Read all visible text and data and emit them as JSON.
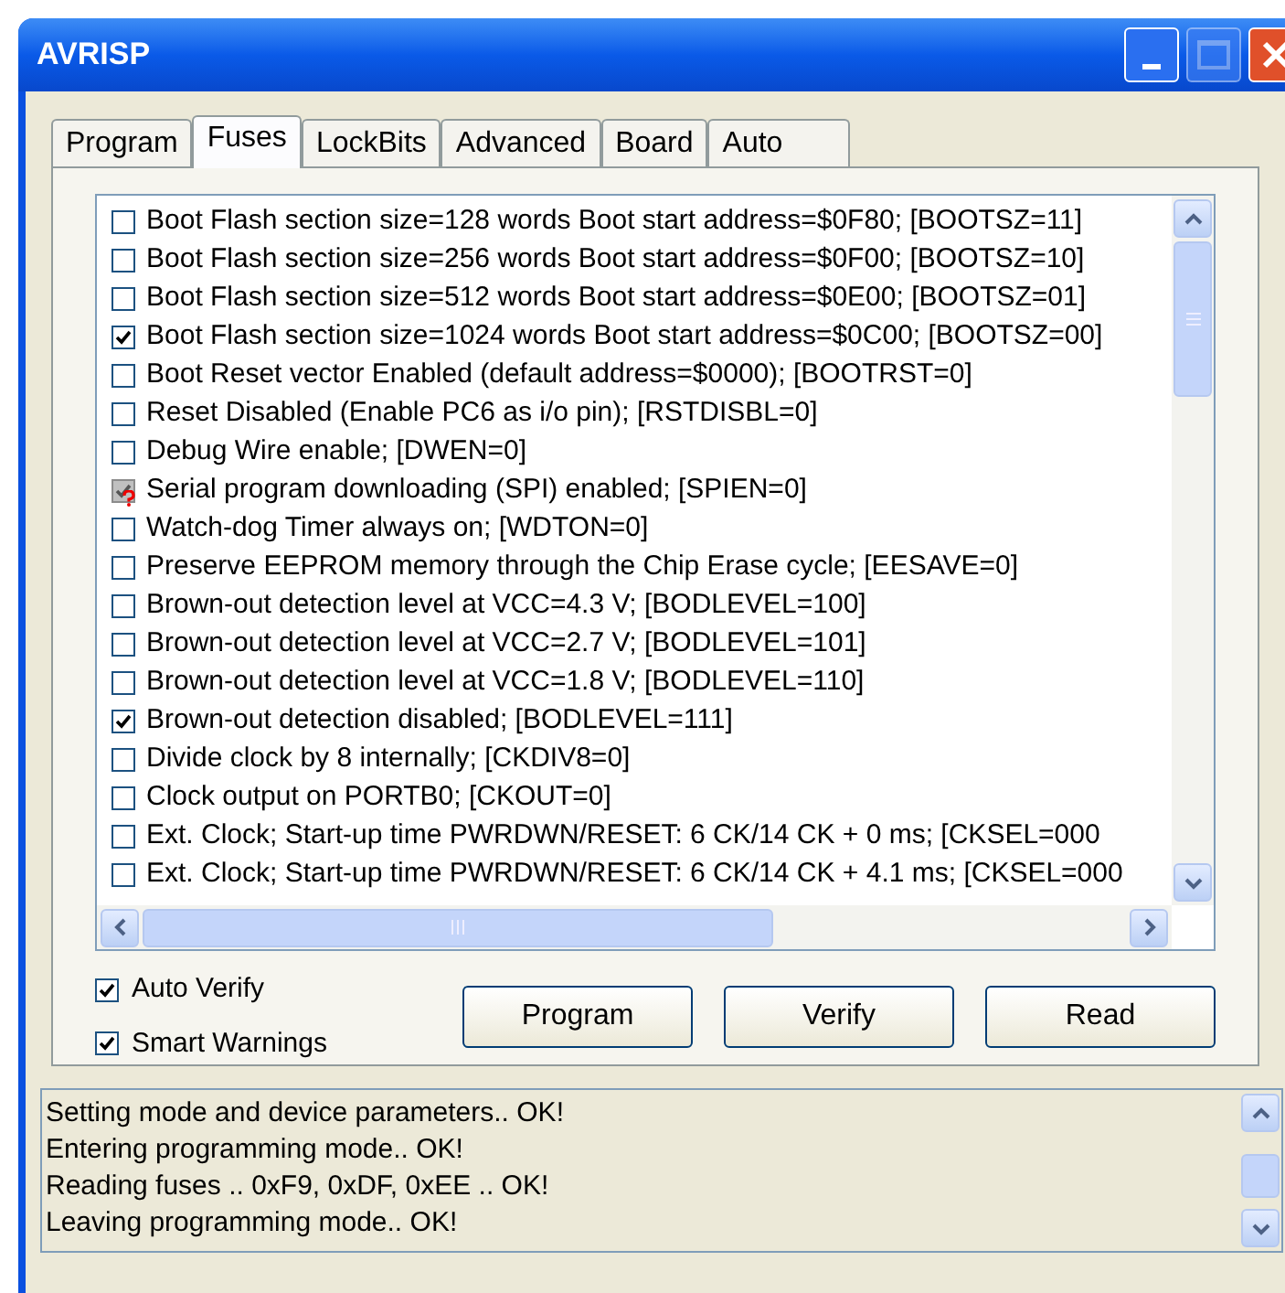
{
  "window": {
    "title": "AVRISP"
  },
  "tabs": [
    {
      "label": "Program",
      "selected": false
    },
    {
      "label": "Fuses",
      "selected": true
    },
    {
      "label": "LockBits",
      "selected": false
    },
    {
      "label": "Advanced",
      "selected": false
    },
    {
      "label": "Board",
      "selected": false
    },
    {
      "label": "Auto",
      "selected": false
    }
  ],
  "fuses": [
    {
      "label": "Boot Flash section size=128 words Boot start address=$0F80; [BOOTSZ=11]",
      "checked": false,
      "locked": false
    },
    {
      "label": "Boot Flash section size=256 words Boot start address=$0F00; [BOOTSZ=10]",
      "checked": false,
      "locked": false
    },
    {
      "label": "Boot Flash section size=512 words Boot start address=$0E00; [BOOTSZ=01]",
      "checked": false,
      "locked": false
    },
    {
      "label": "Boot Flash section size=1024 words Boot start address=$0C00; [BOOTSZ=00]",
      "checked": true,
      "locked": false
    },
    {
      "label": "Boot Reset vector Enabled (default address=$0000); [BOOTRST=0]",
      "checked": false,
      "locked": false
    },
    {
      "label": "Reset Disabled (Enable PC6 as i/o pin); [RSTDISBL=0]",
      "checked": false,
      "locked": false
    },
    {
      "label": "Debug Wire enable; [DWEN=0]",
      "checked": false,
      "locked": false
    },
    {
      "label": "Serial program downloading (SPI) enabled; [SPIEN=0]",
      "checked": true,
      "locked": true
    },
    {
      "label": "Watch-dog Timer always on; [WDTON=0]",
      "checked": false,
      "locked": false
    },
    {
      "label": "Preserve EEPROM memory through the Chip Erase cycle; [EESAVE=0]",
      "checked": false,
      "locked": false
    },
    {
      "label": "Brown-out detection level at VCC=4.3 V; [BODLEVEL=100]",
      "checked": false,
      "locked": false
    },
    {
      "label": "Brown-out detection level at VCC=2.7 V; [BODLEVEL=101]",
      "checked": false,
      "locked": false
    },
    {
      "label": "Brown-out detection level at VCC=1.8 V; [BODLEVEL=110]",
      "checked": false,
      "locked": false
    },
    {
      "label": "Brown-out detection disabled; [BODLEVEL=111]",
      "checked": true,
      "locked": false
    },
    {
      "label": "Divide clock by 8 internally; [CKDIV8=0]",
      "checked": false,
      "locked": false
    },
    {
      "label": "Clock output on PORTB0; [CKOUT=0]",
      "checked": false,
      "locked": false
    },
    {
      "label": "Ext. Clock; Start-up time PWRDWN/RESET: 6 CK/14 CK + 0 ms;   [CKSEL=000",
      "checked": false,
      "locked": false
    },
    {
      "label": "Ext. Clock; Start-up time PWRDWN/RESET: 6 CK/14 CK + 4.1 ms; [CKSEL=000",
      "checked": false,
      "locked": false
    }
  ],
  "options": [
    {
      "label": "Auto Verify",
      "checked": true
    },
    {
      "label": "Smart Warnings",
      "checked": true
    }
  ],
  "buttons": [
    "Program",
    "Verify",
    "Read"
  ],
  "log": [
    "Setting mode and device parameters.. OK!",
    "Entering programming mode.. OK!",
    "Reading fuses .. 0xF9, 0xDF, 0xEE .. OK!",
    "Leaving programming mode.. OK!"
  ]
}
